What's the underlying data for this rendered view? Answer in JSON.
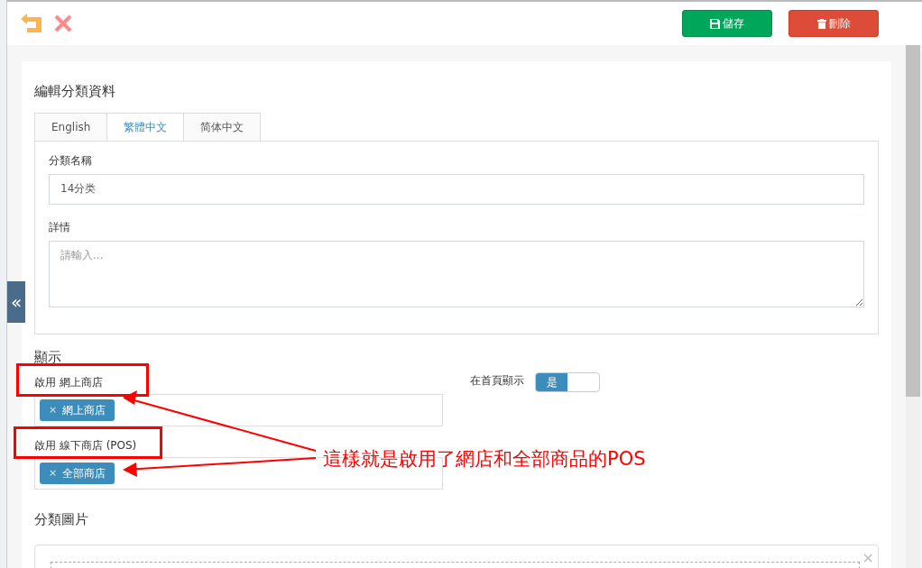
{
  "toolbar": {
    "buttons": [
      {
        "kind": "save",
        "label": "儲存"
      },
      {
        "kind": "delete",
        "label": "刪除"
      }
    ]
  },
  "form": {
    "title": "編輯分類資料",
    "tabs": [
      {
        "label": "English",
        "selected": false
      },
      {
        "label": "繁體中文",
        "selected": true
      },
      {
        "label": "简体中文",
        "selected": false
      }
    ],
    "name_field": {
      "label": "分類名稱",
      "value": "14分类"
    },
    "details_field": {
      "label": "詳情",
      "placeholder": "請輸入..."
    }
  },
  "display": {
    "heading": "顯示",
    "tag_fields": [
      {
        "label": "啟用 網上商店",
        "tags": [
          {
            "remove": "×",
            "label": "網上商店"
          }
        ]
      },
      {
        "label": "啟用 線下商店 (POS)",
        "tags": [
          {
            "remove": "×",
            "label": "全部商店"
          }
        ]
      }
    ],
    "homepage_toggle": {
      "label": "在首頁顯示",
      "on": true,
      "on_text": "是"
    }
  },
  "image": {
    "heading": "分類圖片",
    "remove": "×"
  },
  "collapse_button": {
    "text": "«"
  },
  "annotation": {
    "text": "這樣就是啟用了網店和全部商品的POS"
  }
}
